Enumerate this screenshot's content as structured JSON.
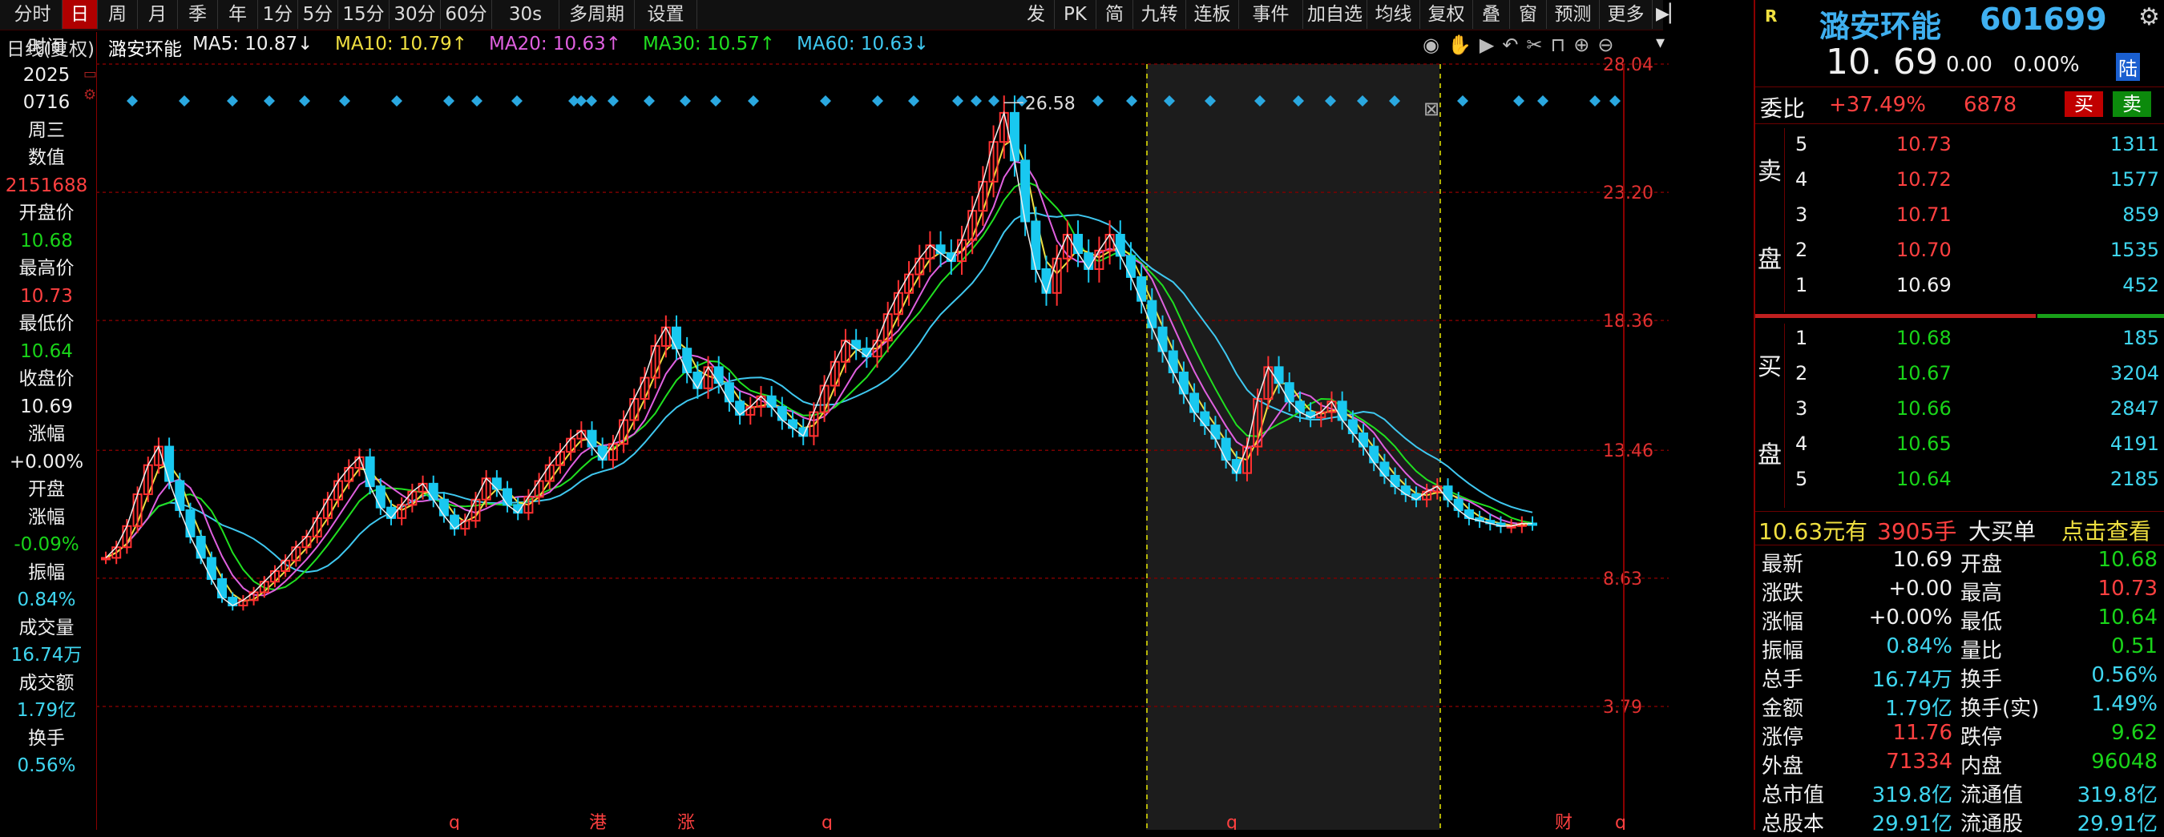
{
  "toolbar": {
    "left_items": [
      "分时",
      "日",
      "周",
      "月",
      "季",
      "年",
      "1分",
      "5分",
      "15分",
      "30分",
      "60分",
      "30s",
      "多周期",
      "设置"
    ],
    "active_index": 1,
    "right_items": [
      "发",
      "PK",
      "简",
      "九转",
      "连板",
      "事件",
      "加自选",
      "均线",
      "复权",
      "叠",
      "窗",
      "预测",
      "更多"
    ]
  },
  "chart_header": {
    "period_label": "日线(复权)",
    "stock_name": "潞安环能",
    "ma": [
      {
        "label": "MA5: 10.87↓",
        "color": "#f0f0f0"
      },
      {
        "label": "MA10: 10.79↑",
        "color": "#f0e040"
      },
      {
        "label": "MA20: 10.63↑",
        "color": "#e060e0"
      },
      {
        "label": "MA30: 10.57↑",
        "color": "#20e020"
      },
      {
        "label": "MA60: 10.63↓",
        "color": "#3fc8f0"
      }
    ]
  },
  "info_column": [
    {
      "text": "时间",
      "color": "#f0f0f0"
    },
    {
      "text": "2025",
      "color": "#f0f0f0"
    },
    {
      "text": "0716",
      "color": "#f0f0f0"
    },
    {
      "text": "周三",
      "color": "#f0f0f0"
    },
    {
      "text": "数值",
      "color": "#f0f0f0"
    },
    {
      "text": "2151688",
      "color": "#ff4040"
    },
    {
      "text": "开盘价",
      "color": "#f0f0f0"
    },
    {
      "text": "10.68",
      "color": "#19d419"
    },
    {
      "text": "最高价",
      "color": "#f0f0f0"
    },
    {
      "text": "10.73",
      "color": "#ff4040"
    },
    {
      "text": "最低价",
      "color": "#f0f0f0"
    },
    {
      "text": "10.64",
      "color": "#19d419"
    },
    {
      "text": "收盘价",
      "color": "#f0f0f0"
    },
    {
      "text": "10.69",
      "color": "#f0f0f0"
    },
    {
      "text": "涨幅",
      "color": "#f0f0f0"
    },
    {
      "text": "+0.00%",
      "color": "#f0f0f0"
    },
    {
      "text": "开盘",
      "color": "#f0f0f0"
    },
    {
      "text": "涨幅",
      "color": "#f0f0f0"
    },
    {
      "text": "-0.09%",
      "color": "#19d419"
    },
    {
      "text": "振幅",
      "color": "#f0f0f0"
    },
    {
      "text": "0.84%",
      "color": "#3fd6f0"
    },
    {
      "text": "成交量",
      "color": "#f0f0f0"
    },
    {
      "text": "16.74万",
      "color": "#3fd6f0"
    },
    {
      "text": "成交额",
      "color": "#f0f0f0"
    },
    {
      "text": "1.79亿",
      "color": "#3fd6f0"
    },
    {
      "text": "换手",
      "color": "#f0f0f0"
    },
    {
      "text": "0.56%",
      "color": "#3fd6f0"
    }
  ],
  "chart_data": {
    "type": "line",
    "price_axis_ticks": [
      "28.04",
      "23.20",
      "18.36",
      "13.46",
      "8.63",
      "3.79"
    ],
    "max_marker": "26.58",
    "highlight_range_label": "selected interval",
    "bottom_markers": [
      "q",
      "q",
      "港",
      "涨",
      "q",
      "q",
      "财",
      "q"
    ],
    "close": [
      9.4,
      9.8,
      10.6,
      11.8,
      12.9,
      13.6,
      12.3,
      11.2,
      10.2,
      9.4,
      8.6,
      7.9,
      7.6,
      7.8,
      8.1,
      8.5,
      8.9,
      9.3,
      9.8,
      10.2,
      10.9,
      11.6,
      12.3,
      12.8,
      13.2,
      12.1,
      11.3,
      10.9,
      11.4,
      11.9,
      12.2,
      11.6,
      11.0,
      10.5,
      10.8,
      11.6,
      12.4,
      12.0,
      11.4,
      11.1,
      11.7,
      12.3,
      12.9,
      13.4,
      13.9,
      14.2,
      13.6,
      13.1,
      13.7,
      14.6,
      15.4,
      16.2,
      17.4,
      18.1,
      17.3,
      16.4,
      15.8,
      16.6,
      16.0,
      15.3,
      14.8,
      15.1,
      15.5,
      15.1,
      14.6,
      14.3,
      14.0,
      14.9,
      15.9,
      16.8,
      17.6,
      17.3,
      17.0,
      17.6,
      18.6,
      19.4,
      20.1,
      20.7,
      21.2,
      20.9,
      20.6,
      21.4,
      22.5,
      23.6,
      25.1,
      26.2,
      24.4,
      22.1,
      20.3,
      19.4,
      20.7,
      21.6,
      20.9,
      20.3,
      21.0,
      21.6,
      20.8,
      20.0,
      19.1,
      18.1,
      17.2,
      16.4,
      15.6,
      14.9,
      14.4,
      13.9,
      13.1,
      12.6,
      13.6,
      15.4,
      16.6,
      16.0,
      15.3,
      14.9,
      14.7,
      14.9,
      15.3,
      14.6,
      14.1,
      13.6,
      13.0,
      12.5,
      12.1,
      11.8,
      11.6,
      11.9,
      12.1,
      11.6,
      11.2,
      10.9,
      10.8,
      10.7,
      10.6,
      10.6,
      10.7,
      10.69
    ]
  },
  "right_panel": {
    "badge": "R",
    "stock_name": "潞安环能",
    "stock_code": "601699",
    "price": "10. 69",
    "change": "0.00",
    "change_pct": "0.00%",
    "tag": "陆",
    "weibi_label": "委比",
    "weibi_pct": "+37.49%",
    "weibi_diff": "6878",
    "buy_btn": "买",
    "sell_btn": "卖",
    "sell_side_label": [
      "卖",
      "盘"
    ],
    "buy_side_label": [
      "买",
      "盘"
    ],
    "asks": [
      {
        "level": "5",
        "price": "10.73",
        "vol": "1311"
      },
      {
        "level": "4",
        "price": "10.72",
        "vol": "1577"
      },
      {
        "level": "3",
        "price": "10.71",
        "vol": "859"
      },
      {
        "level": "2",
        "price": "10.70",
        "vol": "1535"
      },
      {
        "level": "1",
        "price": "10.69",
        "vol": "452"
      }
    ],
    "bids": [
      {
        "level": "1",
        "price": "10.68",
        "vol": "185"
      },
      {
        "level": "2",
        "price": "10.67",
        "vol": "3204"
      },
      {
        "level": "3",
        "price": "10.66",
        "vol": "2847"
      },
      {
        "level": "4",
        "price": "10.65",
        "vol": "4191"
      },
      {
        "level": "5",
        "price": "10.64",
        "vol": "2185"
      }
    ],
    "big_order": {
      "price": "10.63元有",
      "qty": "3905手",
      "label": "大买单",
      "action": "点击查看"
    },
    "stats": [
      {
        "l1": "最新",
        "v1": "10.69",
        "c1": "#f0f0f0",
        "l2": "开盘",
        "v2": "10.68",
        "c2": "#19d419"
      },
      {
        "l1": "涨跌",
        "v1": "+0.00",
        "c1": "#f0f0f0",
        "l2": "最高",
        "v2": "10.73",
        "c2": "#ff4040"
      },
      {
        "l1": "涨幅",
        "v1": "+0.00%",
        "c1": "#f0f0f0",
        "l2": "最低",
        "v2": "10.64",
        "c2": "#19d419"
      },
      {
        "l1": "振幅",
        "v1": "0.84%",
        "c1": "#3fd6f0",
        "l2": "量比",
        "v2": "0.51",
        "c2": "#19d419"
      },
      {
        "l1": "总手",
        "v1": "16.74万",
        "c1": "#3fd6f0",
        "l2": "换手",
        "v2": "0.56%",
        "c2": "#3fd6f0"
      },
      {
        "l1": "金额",
        "v1": "1.79亿",
        "c1": "#3fd6f0",
        "l2": "换手(实)",
        "v2": "1.49%",
        "c2": "#3fd6f0"
      },
      {
        "l1": "涨停",
        "v1": "11.76",
        "c1": "#ff4040",
        "l2": "跌停",
        "v2": "9.62",
        "c2": "#19d419"
      },
      {
        "l1": "外盘",
        "v1": "71334",
        "c1": "#ff4040",
        "l2": "内盘",
        "v2": "96048",
        "c2": "#19d419"
      },
      {
        "l1": "总市值",
        "v1": "319.8亿",
        "c1": "#3fd6f0",
        "l2": "流通值",
        "v2": "319.8亿",
        "c2": "#3fd6f0"
      },
      {
        "l1": "总股本",
        "v1": "29.91亿",
        "c1": "#3fd6f0",
        "l2": "流通股",
        "v2": "29.91亿",
        "c2": "#3fd6f0"
      }
    ]
  }
}
